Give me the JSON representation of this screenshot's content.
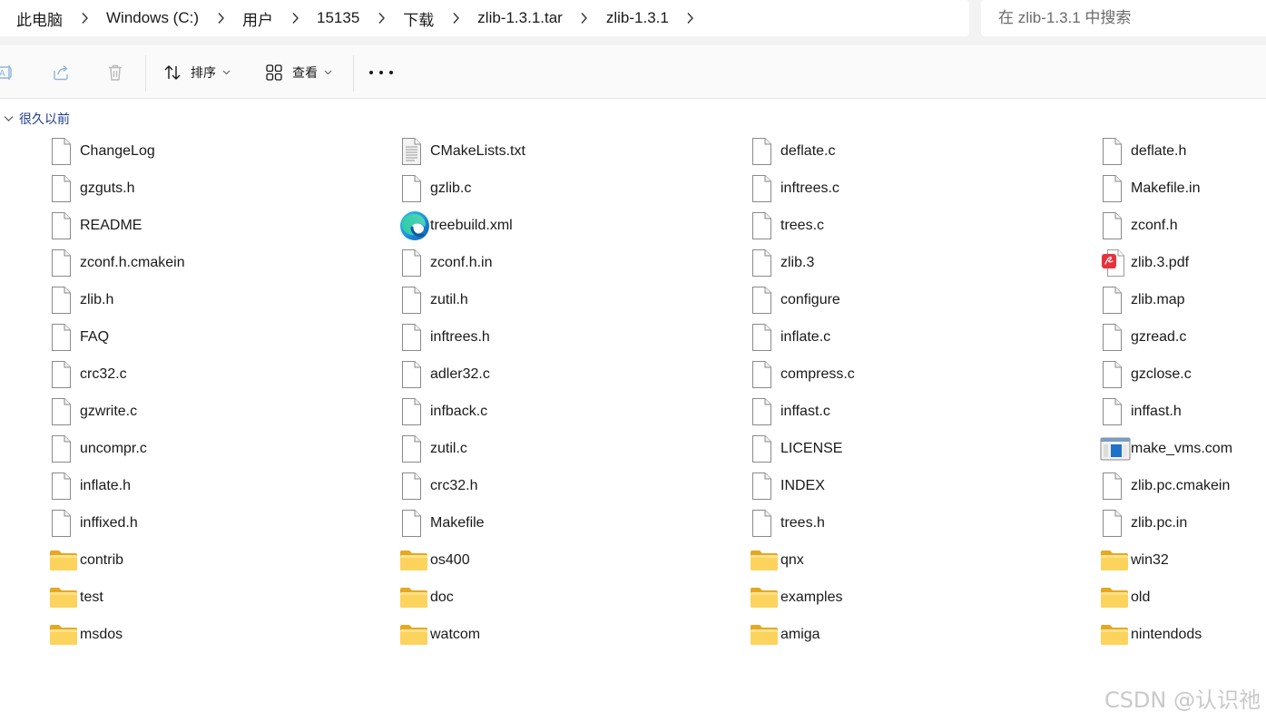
{
  "address_bar": {
    "crumbs": [
      "此电脑",
      "Windows (C:)",
      "用户",
      "15135",
      "下载",
      "zlib-1.3.1.tar",
      "zlib-1.3.1"
    ]
  },
  "search": {
    "placeholder": "在 zlib-1.3.1 中搜索"
  },
  "toolbar": {
    "sort_label": "排序",
    "view_label": "查看"
  },
  "group": {
    "label": "很久以前"
  },
  "columns": [
    [
      {
        "name": "ChangeLog",
        "icon": "file-icon"
      },
      {
        "name": "gzguts.h",
        "icon": "file-icon"
      },
      {
        "name": "README",
        "icon": "file-icon"
      },
      {
        "name": "zconf.h.cmakein",
        "icon": "file-icon"
      },
      {
        "name": "zlib.h",
        "icon": "file-icon"
      },
      {
        "name": "FAQ",
        "icon": "file-icon"
      },
      {
        "name": "crc32.c",
        "icon": "file-icon"
      },
      {
        "name": "gzwrite.c",
        "icon": "file-icon"
      },
      {
        "name": "uncompr.c",
        "icon": "file-icon"
      },
      {
        "name": "inflate.h",
        "icon": "file-icon"
      },
      {
        "name": "inffixed.h",
        "icon": "file-icon"
      },
      {
        "name": "contrib",
        "icon": "folder-icon"
      },
      {
        "name": "test",
        "icon": "folder-icon"
      },
      {
        "name": "msdos",
        "icon": "folder-icon"
      }
    ],
    [
      {
        "name": "CMakeLists.txt",
        "icon": "text-file-icon"
      },
      {
        "name": "gzlib.c",
        "icon": "file-icon"
      },
      {
        "name": "treebuild.xml",
        "icon": "edge-icon"
      },
      {
        "name": "zconf.h.in",
        "icon": "file-icon"
      },
      {
        "name": "zutil.h",
        "icon": "file-icon"
      },
      {
        "name": "inftrees.h",
        "icon": "file-icon"
      },
      {
        "name": "adler32.c",
        "icon": "file-icon"
      },
      {
        "name": "infback.c",
        "icon": "file-icon"
      },
      {
        "name": "zutil.c",
        "icon": "file-icon"
      },
      {
        "name": "crc32.h",
        "icon": "file-icon"
      },
      {
        "name": "Makefile",
        "icon": "file-icon"
      },
      {
        "name": "os400",
        "icon": "folder-icon"
      },
      {
        "name": "doc",
        "icon": "folder-icon"
      },
      {
        "name": "watcom",
        "icon": "folder-icon"
      }
    ],
    [
      {
        "name": "deflate.c",
        "icon": "file-icon"
      },
      {
        "name": "inftrees.c",
        "icon": "file-icon"
      },
      {
        "name": "trees.c",
        "icon": "file-icon"
      },
      {
        "name": "zlib.3",
        "icon": "file-icon"
      },
      {
        "name": "configure",
        "icon": "file-icon"
      },
      {
        "name": "inflate.c",
        "icon": "file-icon"
      },
      {
        "name": "compress.c",
        "icon": "file-icon"
      },
      {
        "name": "inffast.c",
        "icon": "file-icon"
      },
      {
        "name": "LICENSE",
        "icon": "file-icon"
      },
      {
        "name": "INDEX",
        "icon": "file-icon"
      },
      {
        "name": "trees.h",
        "icon": "file-icon"
      },
      {
        "name": "qnx",
        "icon": "folder-icon"
      },
      {
        "name": "examples",
        "icon": "folder-icon"
      },
      {
        "name": "amiga",
        "icon": "folder-icon"
      }
    ],
    [
      {
        "name": "deflate.h",
        "icon": "file-icon"
      },
      {
        "name": "Makefile.in",
        "icon": "file-icon"
      },
      {
        "name": "zconf.h",
        "icon": "file-icon"
      },
      {
        "name": "zlib.3.pdf",
        "icon": "pdf-icon"
      },
      {
        "name": "zlib.map",
        "icon": "file-icon"
      },
      {
        "name": "gzread.c",
        "icon": "file-icon"
      },
      {
        "name": "gzclose.c",
        "icon": "file-icon"
      },
      {
        "name": "inffast.h",
        "icon": "file-icon"
      },
      {
        "name": "make_vms.com",
        "icon": "com-file-icon"
      },
      {
        "name": "zlib.pc.cmakein",
        "icon": "file-icon"
      },
      {
        "name": "zlib.pc.in",
        "icon": "file-icon"
      },
      {
        "name": "win32",
        "icon": "folder-icon"
      },
      {
        "name": "old",
        "icon": "folder-icon"
      },
      {
        "name": "nintendods",
        "icon": "folder-icon"
      }
    ]
  ],
  "watermark": "CSDN @认识祂"
}
